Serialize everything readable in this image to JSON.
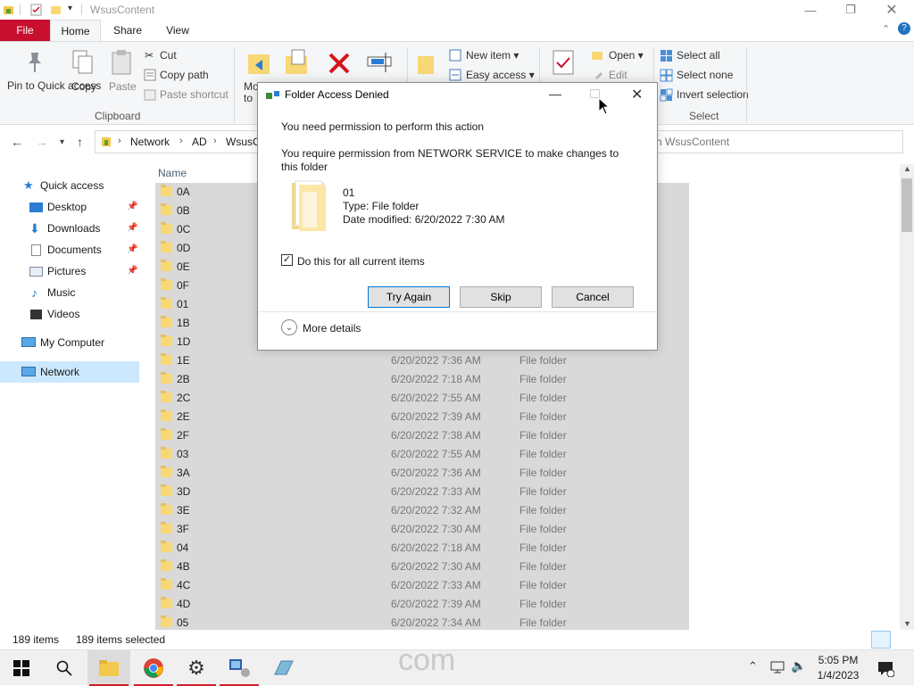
{
  "window": {
    "title": "WsusContent"
  },
  "ribbon_tabs": {
    "file": "File",
    "home": "Home",
    "share": "Share",
    "view": "View"
  },
  "ribbon": {
    "pin_to_quick_access": "Pin to Quick access",
    "copy": "Copy",
    "paste": "Paste",
    "cut": "Cut",
    "copy_path": "Copy path",
    "paste_shortcut": "Paste shortcut",
    "clipboard_group": "Clipboard",
    "move_to_partial": "Mo to",
    "new_item": "New item",
    "easy_access": "Easy access",
    "open": "Open",
    "edit": "Edit",
    "select_all": "Select all",
    "select_none": "Select none",
    "invert_selection": "Invert selection",
    "select_group": "Select"
  },
  "address": {
    "crumbs": [
      "Network",
      "AD",
      "WsusC"
    ],
    "search_placeholder": "ch WsusContent"
  },
  "nav_pane": {
    "items": [
      {
        "label": "Quick access",
        "pinned": false
      },
      {
        "label": "Desktop",
        "pinned": true
      },
      {
        "label": "Downloads",
        "pinned": true
      },
      {
        "label": "Documents",
        "pinned": true
      },
      {
        "label": "Pictures",
        "pinned": true
      },
      {
        "label": "Music",
        "pinned": false
      },
      {
        "label": "Videos",
        "pinned": false
      },
      {
        "label": "My Computer",
        "pinned": false
      },
      {
        "label": "Network",
        "pinned": false
      }
    ]
  },
  "file_list": {
    "column_name": "Name",
    "rows": [
      {
        "name": "0A",
        "date": "",
        "type": ""
      },
      {
        "name": "0B",
        "date": "",
        "type": ""
      },
      {
        "name": "0C",
        "date": "",
        "type": ""
      },
      {
        "name": "0D",
        "date": "",
        "type": ""
      },
      {
        "name": "0E",
        "date": "",
        "type": ""
      },
      {
        "name": "0F",
        "date": "",
        "type": ""
      },
      {
        "name": "01",
        "date": "",
        "type": ""
      },
      {
        "name": "1B",
        "date": "",
        "type": ""
      },
      {
        "name": "1D",
        "date": "",
        "type": ""
      },
      {
        "name": "1E",
        "date": "6/20/2022 7:36 AM",
        "type": "File folder"
      },
      {
        "name": "2B",
        "date": "6/20/2022 7:18 AM",
        "type": "File folder"
      },
      {
        "name": "2C",
        "date": "6/20/2022 7:55 AM",
        "type": "File folder"
      },
      {
        "name": "2E",
        "date": "6/20/2022 7:39 AM",
        "type": "File folder"
      },
      {
        "name": "2F",
        "date": "6/20/2022 7:38 AM",
        "type": "File folder"
      },
      {
        "name": "03",
        "date": "6/20/2022 7:55 AM",
        "type": "File folder"
      },
      {
        "name": "3A",
        "date": "6/20/2022 7:36 AM",
        "type": "File folder"
      },
      {
        "name": "3D",
        "date": "6/20/2022 7:33 AM",
        "type": "File folder"
      },
      {
        "name": "3E",
        "date": "6/20/2022 7:32 AM",
        "type": "File folder"
      },
      {
        "name": "3F",
        "date": "6/20/2022 7:30 AM",
        "type": "File folder"
      },
      {
        "name": "04",
        "date": "6/20/2022 7:18 AM",
        "type": "File folder"
      },
      {
        "name": "4B",
        "date": "6/20/2022 7:30 AM",
        "type": "File folder"
      },
      {
        "name": "4C",
        "date": "6/20/2022 7:33 AM",
        "type": "File folder"
      },
      {
        "name": "4D",
        "date": "6/20/2022 7:39 AM",
        "type": "File folder"
      },
      {
        "name": "05",
        "date": "6/20/2022 7:34 AM",
        "type": "File folder"
      }
    ]
  },
  "status_bar": {
    "items_count": "189 items",
    "selected_count": "189 items selected"
  },
  "dialog": {
    "title": "Folder Access Denied",
    "heading": "You need permission to perform this action",
    "message": "You require permission from NETWORK SERVICE to make changes to this folder",
    "item_name": "01",
    "item_type": "Type: File folder",
    "item_date": "Date modified: 6/20/2022 7:30 AM",
    "checkbox_label": "Do this for all current items",
    "checkbox_checked": true,
    "try_again": "Try Again",
    "skip": "Skip",
    "cancel": "Cancel",
    "more_details": "More details"
  },
  "taskbar": {
    "time": "5:05 PM",
    "date": "1/4/2023",
    "watermark": "com"
  },
  "colors": {
    "accent_red": "#c8102e",
    "selection_gray": "#d9d9d9",
    "folder_yellow": "#f8d775"
  }
}
